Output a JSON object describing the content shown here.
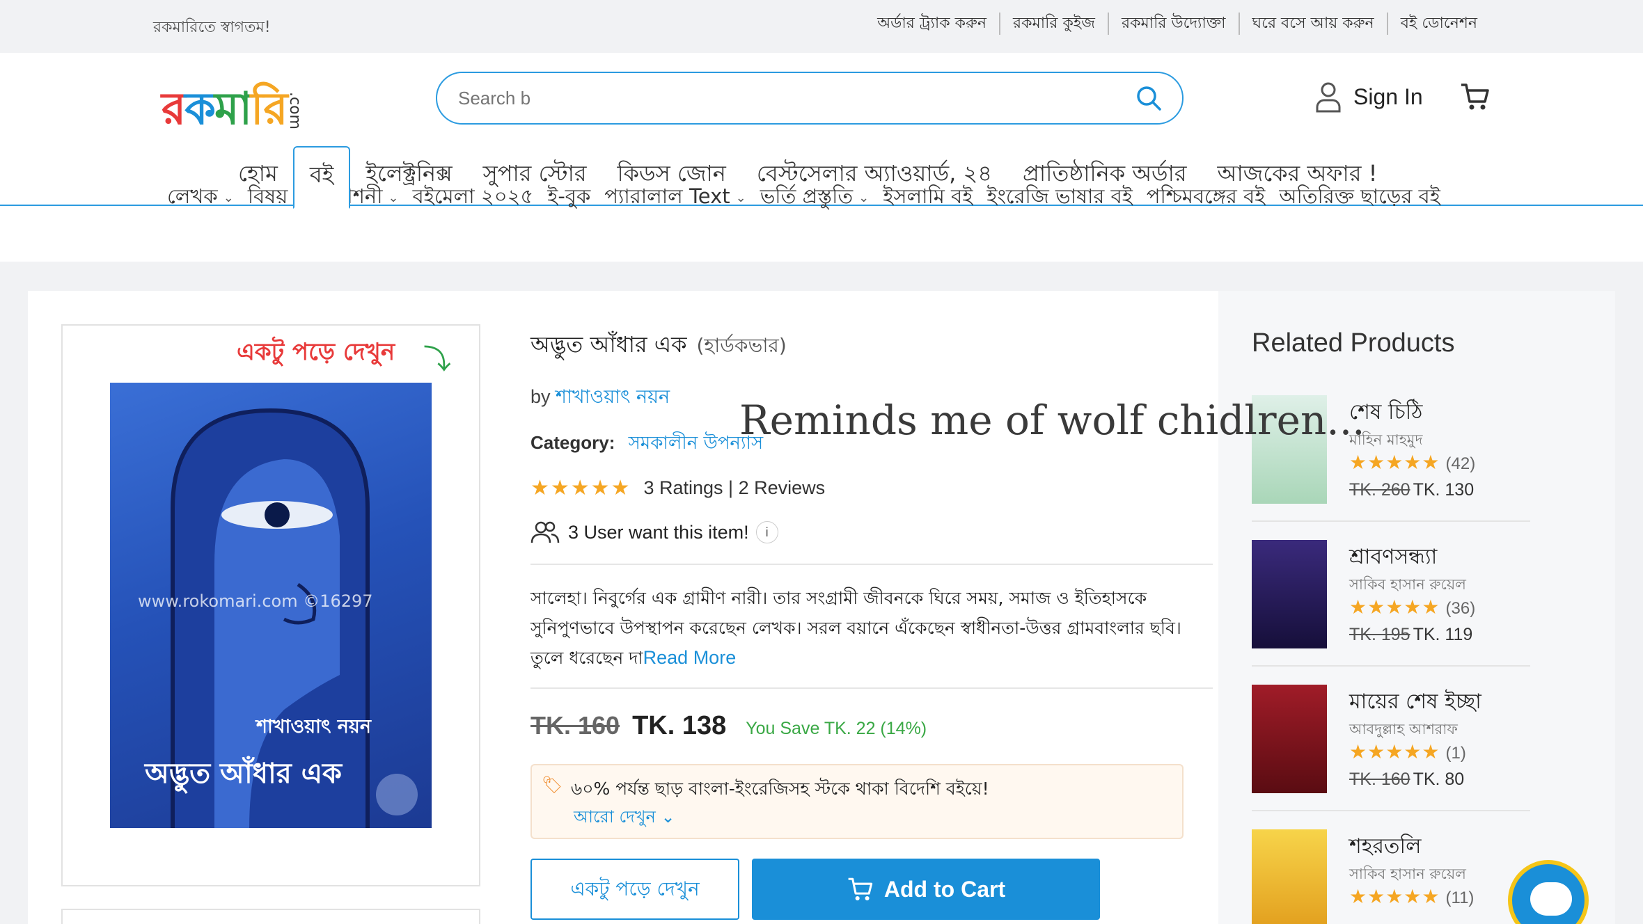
{
  "topbar": {
    "welcome": "রকমারিতে স্বাগতম!",
    "links": [
      "অর্ডার ট্র্যাক করুন",
      "রকমারি কুইজ",
      "রকমারি উদ্যোক্তা",
      "ঘরে বসে আয় করুন",
      "বই ডোনেশন"
    ]
  },
  "header": {
    "logo_text": "রকমারি",
    "logo_suffix": ".com",
    "search_placeholder": "Search b",
    "signin": "Sign In"
  },
  "mainnav": {
    "tabs": [
      "হোম",
      "বই",
      "ইলেক্ট্রনিক্স",
      "সুপার স্টোর",
      "কিডস জোন",
      "বেস্টসেলার অ্যাওয়ার্ড, ২৪",
      "প্রাতিষ্ঠানিক অর্ডার",
      "আজকের অফার !"
    ],
    "active_index": 1
  },
  "subnav": [
    "লেখক",
    "বিষয়",
    "প্রকাশনী",
    "বইমেলা ২০২৫",
    "ই-বুক",
    "প্যারালাল Text",
    "ভর্তি প্রস্তুতি",
    "ইসলামি বই",
    "ইংরেজি ভাষার বই",
    "পশ্চিমবঙ্গের বই",
    "অতিরিক্ত ছাড়ের বই"
  ],
  "preview": {
    "peek_label": "একটু পড়ে দেখুন",
    "cover_watermark": "www.rokomari.com  ©16297",
    "cover_author": "শাখাওয়াৎ নয়ন",
    "cover_title": "অদ্ভুত আঁধার এক"
  },
  "product": {
    "title": "অদ্ভুত আঁধার এক",
    "binding": "(হার্ডকভার)",
    "by_label": "by",
    "author": "শাখাওয়াৎ নয়ন",
    "category_label": "Category:",
    "category": "সমকালীন উপন্যাস",
    "stars": "★★★★★",
    "rating_value": 4.5,
    "ratings_text": "3 Ratings | 2 Reviews",
    "want_text": "3 User want this item!",
    "info_icon": "i",
    "description": "সালেহা। নিবুর্গের এক গ্রামীণ নারী। তার সংগ্রামী জীবনকে ঘিরে সময়, সমাজ ও ইতিহাসকে সুনিপুণভাবে উপস্থাপন করেছেন লেখক। সরল বয়ানে এঁকেছেন স্বাধীনতা-উত্তর গ্রামবাংলার ছবি। তুলে ধরেছেন দা",
    "read_more": "Read More",
    "old_price": "TK. 160",
    "new_price": "TK. 138",
    "save_text": "You Save TK. 22 (14%)",
    "promo_text": "৬০% পর্যন্ত ছাড় বাংলা-ইংরেজিসহ স্টকে থাকা বিদেশি বইয়ে!",
    "promo_more": "আরো দেখুন",
    "peek_button": "একটু পড়ে দেখুন",
    "cart_button": "Add to Cart"
  },
  "related": {
    "heading": "Related Products",
    "items": [
      {
        "name": "শেষ চিঠি",
        "author": "মাহিন মাহমুদ",
        "stars": "★★★★★",
        "rating": 4.5,
        "count": "(42)",
        "old": "TK. 260",
        "new": "TK. 130",
        "color": "#cfe8d8"
      },
      {
        "name": "শ্রাবণসন্ধ্যা",
        "author": "সাকিব হাসান রুয়েল",
        "stars": "★★★★★",
        "rating": 4.5,
        "count": "(36)",
        "old": "TK. 195",
        "new": "TK. 119",
        "color": "#2a1e5c"
      },
      {
        "name": "মায়ের শেষ ইচ্ছা",
        "author": "আবদুল্লাহ আশরাফ",
        "stars": "★★★★★",
        "rating": 5,
        "count": "(1)",
        "old": "TK. 160",
        "new": "TK. 80",
        "color": "#8a1620"
      },
      {
        "name": "শহরতলি",
        "author": "সাকিব হাসান রুয়েল",
        "stars": "★★★★★",
        "rating": 5,
        "count": "(11)",
        "old": "",
        "new": "",
        "color": "#f2c230"
      }
    ]
  },
  "overlay_comment": "Reminds me of wolf chidlren..."
}
